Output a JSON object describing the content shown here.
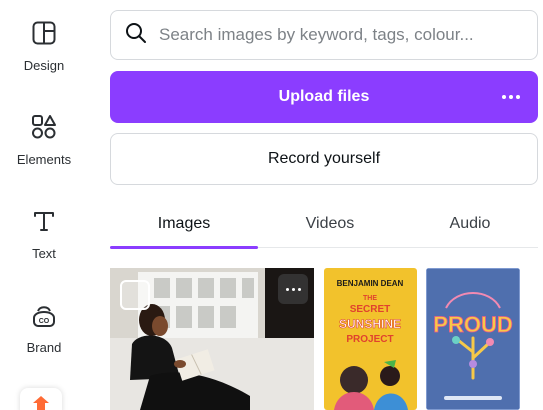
{
  "sidebar": {
    "items": [
      {
        "label": "Design",
        "icon": "layout-icon"
      },
      {
        "label": "Elements",
        "icon": "shapes-icon"
      },
      {
        "label": "Text",
        "icon": "text-t-icon"
      },
      {
        "label": "Brand",
        "icon": "brand-icon"
      }
    ]
  },
  "search": {
    "placeholder": "Search images by keyword, tags, colour..."
  },
  "actions": {
    "upload_label": "Upload files",
    "record_label": "Record yourself"
  },
  "tabs": [
    {
      "label": "Images",
      "active": true
    },
    {
      "label": "Videos",
      "active": false
    },
    {
      "label": "Audio",
      "active": false
    }
  ],
  "colors": {
    "accent": "#8b3dff",
    "book1_cover": "#f2c22c",
    "book2_cover": "#4f6fae"
  },
  "thumbnails": [
    {
      "type": "photo",
      "subject": "woman reading a book by a window"
    },
    {
      "type": "book-cover",
      "author": "BENJAMIN DEAN",
      "title_lines": [
        "THE",
        "SECRET",
        "SUNSHINE",
        "PROJECT"
      ]
    },
    {
      "type": "book-cover",
      "title": "PROUD"
    }
  ]
}
